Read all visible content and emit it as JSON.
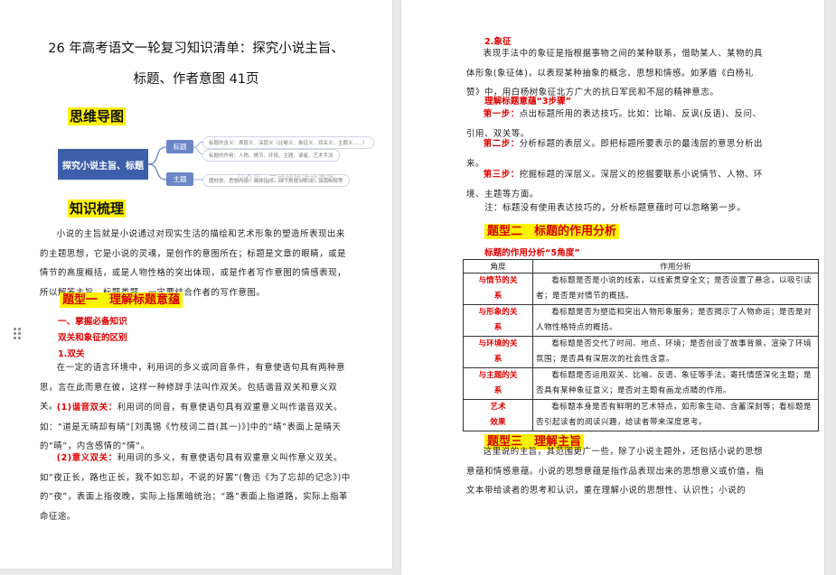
{
  "left_page": {
    "title_line1": "26 年高考语文一轮复习知识清单：探究小说主旨、",
    "title_line2": "标题、作者意图 41页",
    "mindmap_heading": "思维导图",
    "mindmap": {
      "root": "探究小说主旨、标题",
      "node_title": "标题",
      "node_theme": "主题",
      "leaf1": "标题的含义：表层义、深层义（比喻义、象征义、双关义、主题义......）",
      "leaf2": "标题的作用：人物、情节、环境、主题、读者、艺术手法",
      "leaf3": "题材类、思想内容、具体指向、四个角度分析法、谋篇布局等",
      "watermark": "公众号 · 三哥领航语文资源"
    },
    "knowledge_heading": "知识梳理",
    "intro_paragraph": "小说的主旨就是小说通过对现实生活的描绘和艺术形象的塑造所表现出来的主题思想，它是小说的灵魂，是创作的意图所在；标题是文章的眼睛，或是情节的高度概括，或是人物性格的突出体现，或是作者写作意图的情感表现，所以解答主旨、标题类题，一定要结合作者的写作意图。",
    "type1_heading": "题型一　理解标题意蕴",
    "sub_heading_1": "一、掌握必备知识",
    "sub_heading_2": "双关和象征的区别",
    "point1_title": "1.双关",
    "point1_paragraph": "在一定的语言环境中，利用词的多义或同音条件，有意使语句具有两种意思，言在此而意在彼，这样一种修辞手法叫作双关。包括谐音双关和意义双关。",
    "p1_label": "(1)谐音双关：",
    "p1_text": "利用词的同音，有意使语句具有双重意义叫作谐音双关。如：“道是无晴却有晴”[刘禹锡《竹枝词二首(其一)》]中的“晴”表面上是晴天的“晴”，内含感情的“情”。",
    "p2_label": "(2)意义双关：",
    "p2_text": "利用词的多义，有意使语句具有双重意义叫作意义双关。如“夜正长，路也正长，我不如忘却，不说的好罢”(鲁迅《为了忘却的记念》)中的“夜”，表面上指夜晚，实际上指黑暗统治；“路”表面上指道路，实际上指革命征途。"
  },
  "right_page": {
    "point2_title": "2.象征",
    "point2_paragraph": "表现手法中的象征是指根据事物之间的某种联系，借助某人、某物的具体形象(象征体)，以表现某种抽象的概念、思想和情感。如茅盾《白杨礼赞》中，用白杨树象征北方广大的抗日军民和不屈的精神意志。",
    "steps_heading": "理解标题意蕴“3步骤”",
    "step1_label": "第一步：",
    "step1_text": "点出标题所用的表达技巧。比如：比喻、反讽(反语)、反问、引用、双关等。",
    "step2_label": "第二步：",
    "step2_text": "分析标题的表层义。即把标题所要表示的最浅层的意思分析出来。",
    "step3_label": "第三步：",
    "step3_text": "挖掘标题的深层义。深层义的挖掘要联系小说情节、人物、环境、主题等方面。",
    "note": "注：标题没有使用表达技巧的，分析标题意蕴时可以忽略第一步。",
    "type2_heading": "题型二　标题的作用分析",
    "angles_heading": "标题的作用分析“5角度”",
    "table": {
      "header_angle": "角度",
      "header_analysis": "作用分析",
      "rows": [
        {
          "angle_line1": "与情节的关",
          "angle_line2": "系",
          "analysis": "看标题是否是小说的线索，以线索贯穿全文；是否设置了悬念，以吸引读者；是否是对情节的概括。"
        },
        {
          "angle_line1": "与形象的关",
          "angle_line2": "系",
          "analysis": "看标题是否为塑造和突出人物形象服务；是否揭示了人物命运；是否是对人物性格特点的概括。"
        },
        {
          "angle_line1": "与环境的关",
          "angle_line2": "系",
          "analysis": "看标题是否交代了时间、地点、环境；是否创设了故事背景，渲染了环境氛围；是否具有深层次的社会性含意。"
        },
        {
          "angle_line1": "与主题的关",
          "angle_line2": "系",
          "analysis": "看标题是否运用双关、比喻、反语、象征等手法，寄托情感深化主题；是否具有某种象征意义；是否对主题有画龙点睛的作用。"
        },
        {
          "angle_line1": "艺术",
          "angle_line2": "效果",
          "analysis": "看标题本身是否有鲜明的艺术特点，如形象生动、含蓄深刻等；看标题是否引起读者的阅读兴趣，给读者带来深度思考。"
        }
      ]
    },
    "type3_heading": "题型三　理解主旨",
    "type3_paragraph": "这里说的主旨，其范围更广一些，除了小说主题外，还包括小说的思想意蕴和情感意蕴。小说的思想意蕴是指作品表现出来的思想意义或价值，指文本带给读者的思考和认识，重在理解小说的思想性、认识性；小说的"
  },
  "colors": {
    "highlight": "#fff200",
    "red": "#e00000",
    "mindmap_root": "#3d5fa9",
    "background": "#e9e9ea"
  }
}
